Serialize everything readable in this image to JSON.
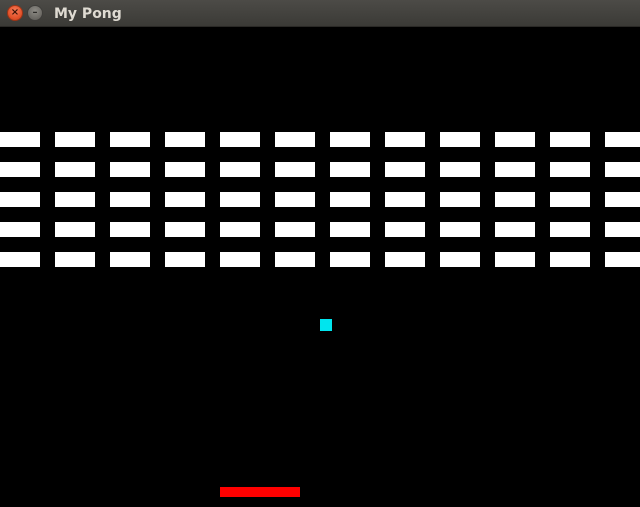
{
  "window": {
    "title": "My Pong",
    "close_icon": "×",
    "minimize_icon": "–"
  },
  "game": {
    "background_color": "#000000",
    "brick_color": "#ffffff",
    "ball_color": "#00e5ee",
    "paddle_color": "#ff0000",
    "brick_rows": 5,
    "brick_columns": 12
  }
}
